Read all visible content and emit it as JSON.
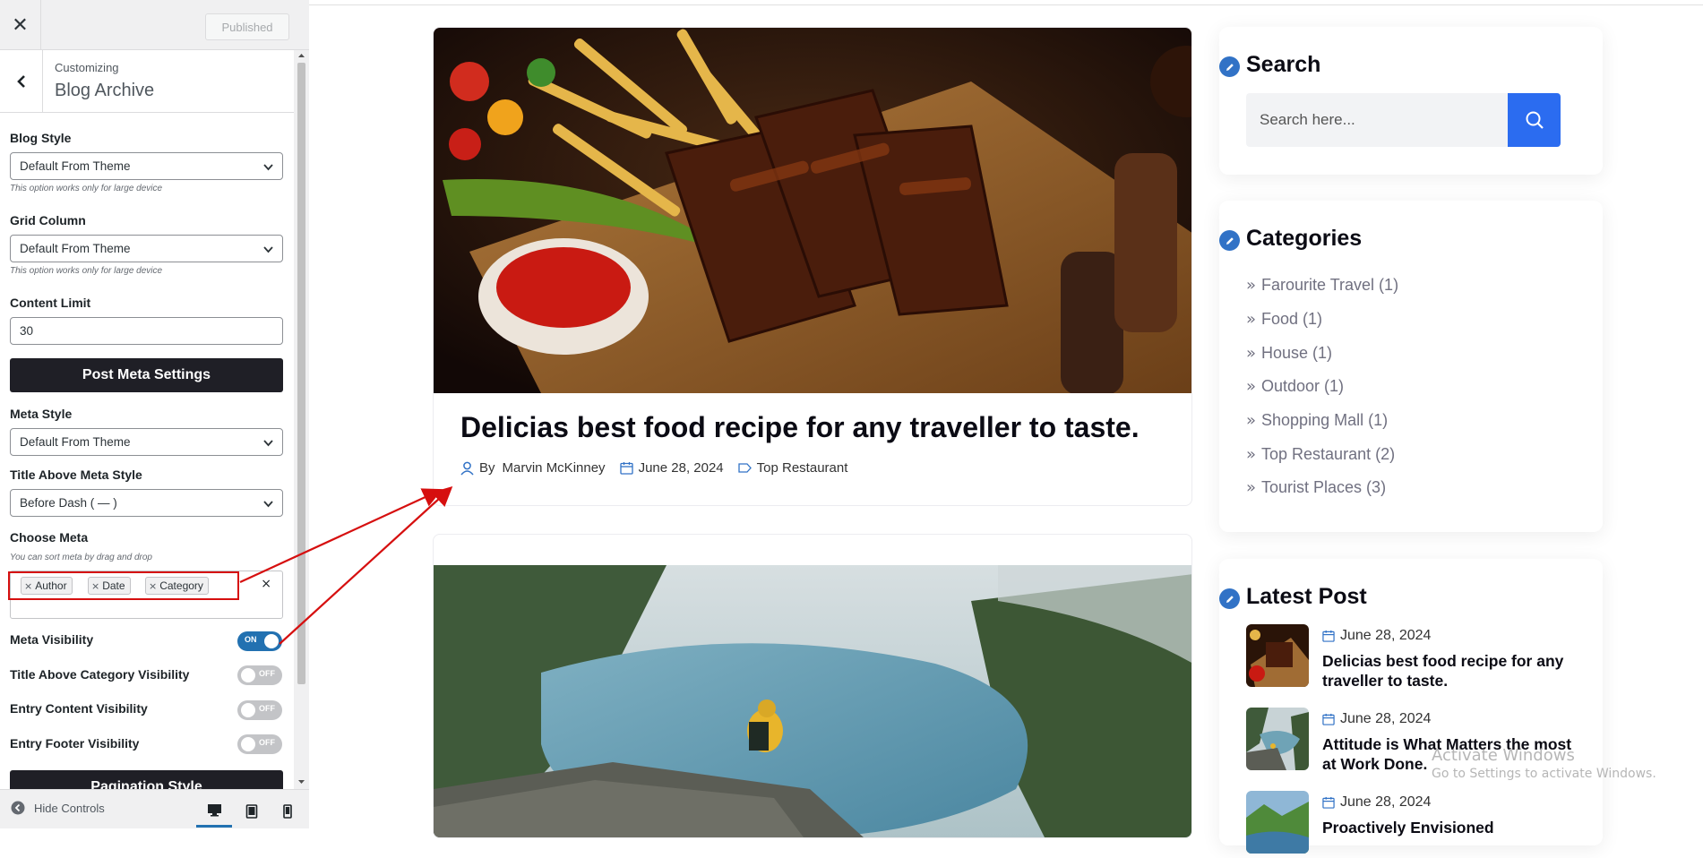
{
  "customizer": {
    "published_label": "Published",
    "customizing_label": "Customizing",
    "section_title": "Blog Archive",
    "blog_style": {
      "label": "Blog Style",
      "value": "Default From Theme",
      "note": "This option works only for large device"
    },
    "grid_column": {
      "label": "Grid Column",
      "value": "Default From Theme",
      "note": "This option works only for large device"
    },
    "content_limit": {
      "label": "Content Limit",
      "value": "30"
    },
    "post_meta_settings_label": "Post Meta Settings",
    "meta_style": {
      "label": "Meta Style",
      "value": "Default From Theme"
    },
    "title_above_meta_style": {
      "label": "Title Above Meta Style",
      "value": "Before Dash ( — )"
    },
    "choose_meta": {
      "label": "Choose Meta",
      "note": "You can sort meta by drag and drop",
      "chips": [
        "Author",
        "Date",
        "Category"
      ]
    },
    "toggles": [
      {
        "label": "Meta Visibility",
        "state": "ON"
      },
      {
        "label": "Title Above Category Visibility",
        "state": "OFF"
      },
      {
        "label": "Entry Content Visibility",
        "state": "OFF"
      },
      {
        "label": "Entry Footer Visibility",
        "state": "OFF"
      }
    ],
    "pagination_style_label": "Pagination Style",
    "hide_controls_label": "Hide Controls"
  },
  "preview": {
    "post1": {
      "title": "Delicias best food recipe for any traveller to taste.",
      "by_label": "By",
      "author": "Marvin McKinney",
      "date": "June 28, 2024",
      "category": "Top Restaurant"
    },
    "search_widget": {
      "title": "Search",
      "placeholder": "Search here..."
    },
    "categories_widget": {
      "title": "Categories",
      "items": [
        "Farourite Travel (1)",
        "Food (1)",
        "House (1)",
        "Outdoor (1)",
        "Shopping Mall (1)",
        "Top Restaurant (2)",
        "Tourist Places (3)"
      ]
    },
    "latest_widget": {
      "title": "Latest Post",
      "items": [
        {
          "date": "June 28, 2024",
          "title": "Delicias best food recipe for any traveller to taste."
        },
        {
          "date": "June 28, 2024",
          "title": "Attitude is What Matters the most at Work Done."
        },
        {
          "date": "June 28, 2024",
          "title": "Proactively Envisioned"
        }
      ]
    },
    "watermark": {
      "title": "Activate Windows",
      "subtitle": "Go to Settings to activate Windows."
    }
  },
  "colors": {
    "accent": "#2271b1",
    "search_button": "#2b6cf0",
    "annotation": "#d60f0f",
    "dark_button": "#1f1f26"
  }
}
